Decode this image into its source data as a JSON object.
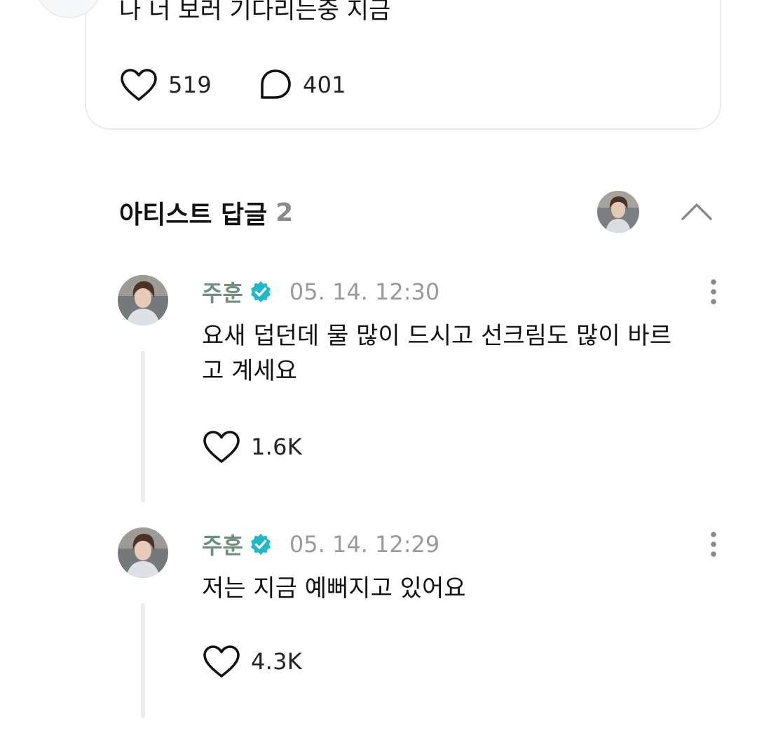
{
  "post": {
    "text": "나 너 보러 기다리는중 지금",
    "likes": "519",
    "comments": "401"
  },
  "replies_section": {
    "title": "아티스트 답글",
    "count": "2"
  },
  "replies": [
    {
      "author": "주훈",
      "time": "05. 14. 12:30",
      "text": "요새 덥던데 물 많이 드시고 선크림도 많이 바르고 계세요",
      "likes": "1.6K"
    },
    {
      "author": "주훈",
      "time": "05. 14. 12:29",
      "text": "저는 지금 예뻐지고 있어요",
      "likes": "4.3K"
    }
  ],
  "colors": {
    "author": "#6f8f7f",
    "verified_badge": "#1fb9c9",
    "muted": "#9a9a9a",
    "border": "#ebebeb"
  },
  "icons": [
    "heart-icon",
    "comment-bubble-icon",
    "verified-badge-icon",
    "chevron-up-icon",
    "more-vertical-icon"
  ]
}
